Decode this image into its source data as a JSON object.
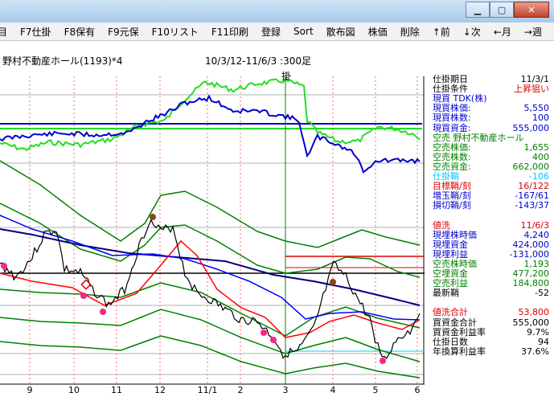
{
  "window": {
    "minimize_icon": "minimize-icon",
    "maximize_icon": "maximize-icon",
    "close_icon": "close-icon"
  },
  "menu": [
    "目",
    "F7仕掛",
    "F8保有",
    "F9元保",
    "F10リスト",
    "F11印刷",
    "登録",
    "Sort",
    "散布図",
    "株価",
    "削除",
    "↑前",
    "↓次",
    "←月",
    "→週"
  ],
  "chart": {
    "stock_label": "野村不動産ホール(1193)*4",
    "range_label": "10/3/12-11/6/3 :300足",
    "marker_label": "掛",
    "x_ticks": [
      "9",
      "10",
      "11",
      "12",
      "11/1",
      "2",
      "3",
      "4",
      "5",
      "6"
    ]
  },
  "panel": {
    "rows": [
      {
        "label": "仕掛期日",
        "value": "11/3/1",
        "color": "black"
      },
      {
        "label": "仕掛条件",
        "value": "上昇狙い",
        "color": "black",
        "value_color": "red"
      },
      {
        "label": "現買  TDK(株)",
        "value": "",
        "color": "blue"
      },
      {
        "label": "現買株価:",
        "value": "5,550",
        "color": "blue"
      },
      {
        "label": "現買株数:",
        "value": "100",
        "color": "blue"
      },
      {
        "label": "現買資金:",
        "value": "555,000",
        "color": "blue"
      },
      {
        "label": "空売  野村不動産ホール",
        "value": "",
        "color": "green"
      },
      {
        "label": "空売株価:",
        "value": "1,655",
        "color": "green"
      },
      {
        "label": "空売株数:",
        "value": "400",
        "color": "green"
      },
      {
        "label": "空売資金:",
        "value": "662,000",
        "color": "green"
      },
      {
        "label": "仕掛鞘",
        "value": "-106",
        "color": "cyan"
      },
      {
        "label": "目標鞘/刻",
        "value": "16/122",
        "color": "red"
      },
      {
        "label": "増玉鞘/刻",
        "value": "-167/61",
        "color": "blue"
      },
      {
        "label": "損切鞘/刻",
        "value": "-143/37",
        "color": "blue"
      },
      {
        "label": "",
        "value": "",
        "color": "black"
      },
      {
        "label": "値洗",
        "value": "11/6/3",
        "color": "red"
      },
      {
        "label": "現埋株時価",
        "value": "4,240",
        "color": "blue"
      },
      {
        "label": "現埋資金",
        "value": "424,000",
        "color": "blue"
      },
      {
        "label": "現埋利益",
        "value": "-131,000",
        "color": "blue"
      },
      {
        "label": "空売株時価",
        "value": "1,193",
        "color": "green"
      },
      {
        "label": "空埋資金",
        "value": "477,200",
        "color": "green"
      },
      {
        "label": "空売利益",
        "value": "184,800",
        "color": "green"
      },
      {
        "label": "最新鞘",
        "value": "-52",
        "color": "black"
      },
      {
        "label": "",
        "value": "",
        "color": "black"
      },
      {
        "label": "値洗合計",
        "value": "53,800",
        "color": "red"
      },
      {
        "label": "買資金合計",
        "value": "555,000",
        "color": "black"
      },
      {
        "label": "買資金利益率",
        "value": "9.7%",
        "color": "black"
      },
      {
        "label": "仕掛日数",
        "value": "94",
        "color": "black"
      },
      {
        "label": "年換算利益率",
        "value": "37.6%",
        "color": "black"
      }
    ]
  },
  "colors": {
    "blue_line": "#0000cc",
    "green_line": "#22dd22",
    "band": "#008000",
    "price": "#000000",
    "ma_red": "#ff0000",
    "pink": "#ff2288",
    "brown": "#8b4513"
  }
}
